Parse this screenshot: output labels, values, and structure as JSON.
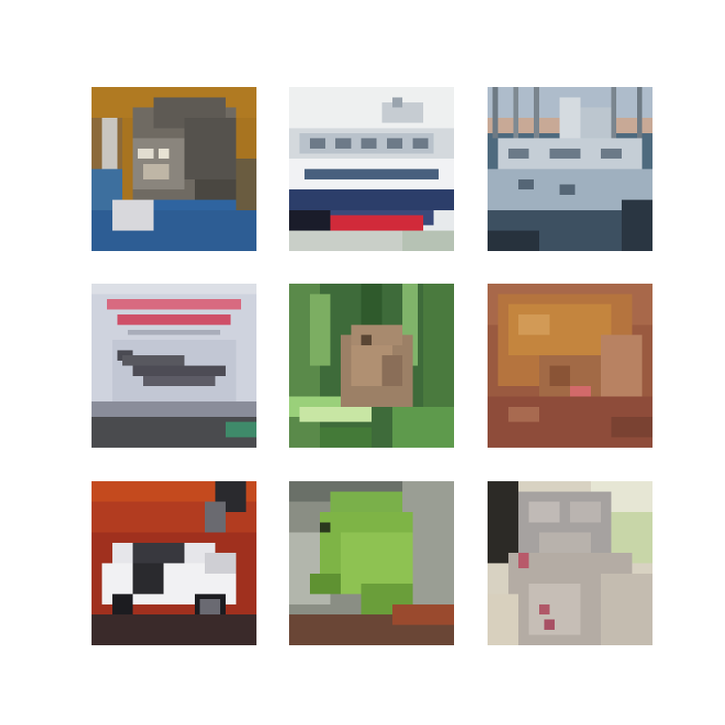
{
  "grid": {
    "rows": 3,
    "cols": 3,
    "tiles": [
      {
        "subject": "cat"
      },
      {
        "subject": "ship"
      },
      {
        "subject": "ship"
      },
      {
        "subject": "airplane"
      },
      {
        "subject": "frog"
      },
      {
        "subject": "frog"
      },
      {
        "subject": "automobile"
      },
      {
        "subject": "frog"
      },
      {
        "subject": "cat"
      }
    ]
  }
}
